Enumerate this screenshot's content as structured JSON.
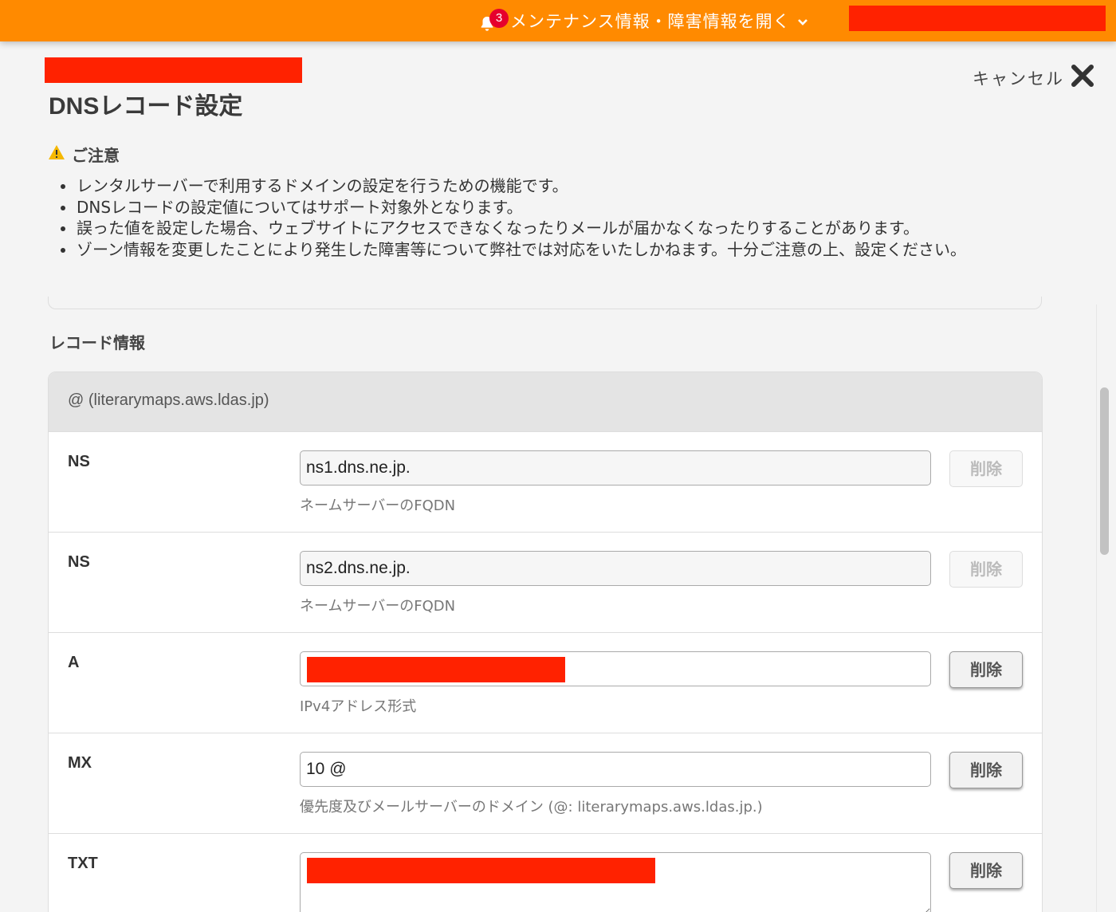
{
  "topbar": {
    "notification_count": "3",
    "maintenance_label": "メンテナンス情報・障害情報を開く"
  },
  "header": {
    "title": "DNSレコード設定",
    "cancel_label": "キャンセル"
  },
  "notice": {
    "heading": "ご注意",
    "items": [
      "レンタルサーバーで利用するドメインの設定を行うための機能です。",
      "DNSレコードの設定値についてはサポート対象外となります。",
      "誤った値を設定した場合、ウェブサイトにアクセスできなくなったりメールが届かなくなったりすることがあります。",
      "ゾーン情報を変更したことにより発生した障害等について弊社では対応をいたしかねます。十分ご注意の上、設定ください。"
    ]
  },
  "records": {
    "section_title": "レコード情報",
    "zone_label": "@ (literarymaps.aws.ldas.jp)",
    "delete_label": "削除",
    "rows": [
      {
        "type": "NS",
        "value": "ns1.dns.ne.jp.",
        "hint": "ネームサーバーのFQDN",
        "deletable": false
      },
      {
        "type": "NS",
        "value": "ns2.dns.ne.jp.",
        "hint": "ネームサーバーのFQDN",
        "deletable": false
      },
      {
        "type": "A",
        "value": "",
        "hint": "IPv4アドレス形式",
        "deletable": true
      },
      {
        "type": "MX",
        "value": "10 @",
        "hint": "優先度及びメールサーバーのドメイン (@: literarymaps.aws.ldas.jp.)",
        "deletable": true
      },
      {
        "type": "TXT",
        "value": "",
        "hint": "",
        "deletable": true
      }
    ]
  },
  "colors": {
    "topbar": "#ff8a00",
    "badge": "#e6002d",
    "redaction": "#ff2200",
    "warning": "#f5b800"
  },
  "icons": [
    "bell-icon",
    "chevron-down-icon",
    "close-icon",
    "warning-icon"
  ]
}
